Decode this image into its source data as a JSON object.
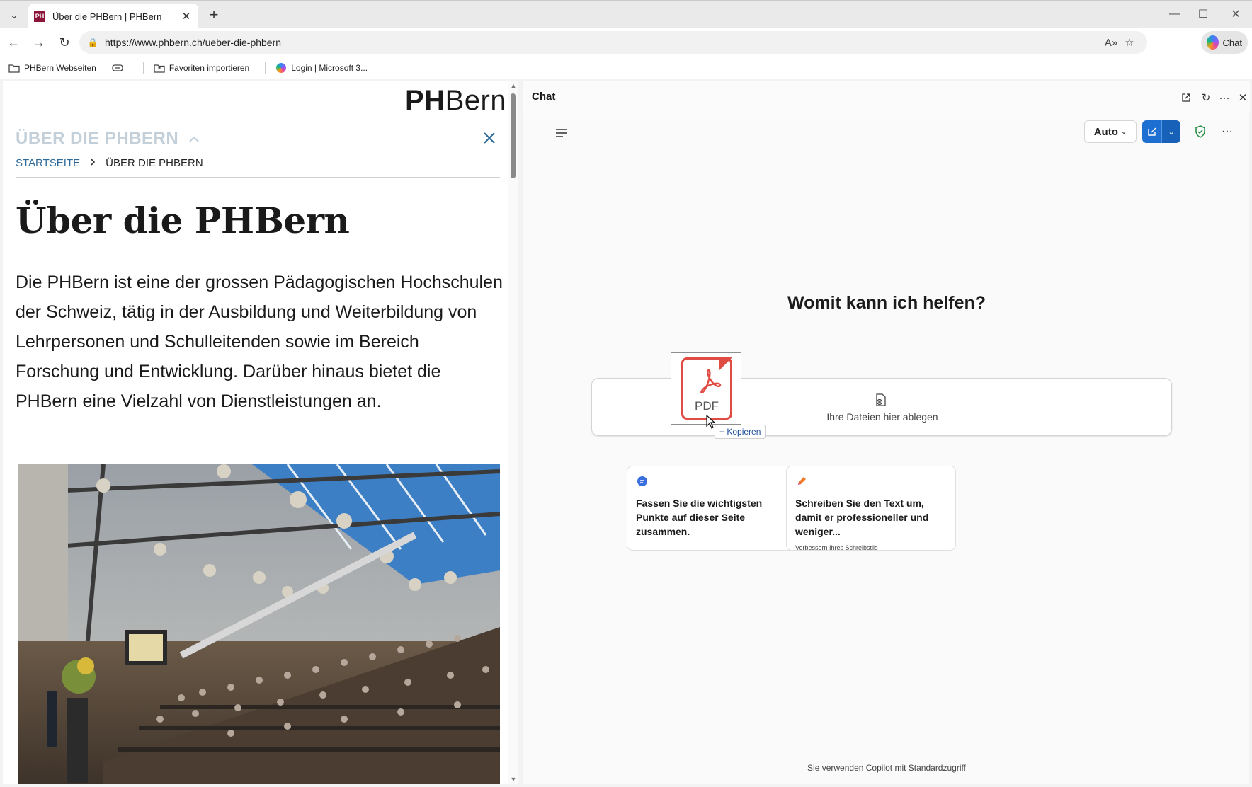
{
  "browser": {
    "tab": {
      "favicon_text": "PH",
      "title": "Über die PHBern | PHBern"
    },
    "url": "https://www.phbern.ch/ueber-die-phbern",
    "chat_button": "Chat",
    "favorites": [
      {
        "label": "PHBern Webseiten",
        "icon": "folder-icon"
      },
      {
        "label": "Favoriten importieren",
        "icon": "import-icon"
      },
      {
        "label": "Login | Microsoft 3...",
        "icon": "microsoft-icon"
      }
    ]
  },
  "page": {
    "logo_bold": "PH",
    "logo_rest": "Bern",
    "section_title": "ÜBER DIE PHBERN",
    "breadcrumb": {
      "home": "STARTSEITE",
      "current": "ÜBER DIE PHBERN"
    },
    "heading": "Über die PHBern",
    "lead": "Die PHBern ist eine der grossen Pädagogischen Hochschulen der Schweiz, tätig in der Ausbildung und Weiterbildung von Lehrpersonen und Schulleitenden sowie im Bereich Forschung und Entwicklung. Darüber hinaus bietet die PHBern eine Vielzahl von Dienstleistungen an."
  },
  "copilot": {
    "title": "Chat",
    "mode": "Auto",
    "greeting": "Womit kann ich helfen?",
    "dropzone_text": "Ihre Dateien hier ablegen",
    "drag_file_label": "PDF",
    "copy_tooltip": "+ Kopieren",
    "cards": [
      {
        "text": "Fassen Sie die wichtigsten Punkte auf dieser Seite zusammen.",
        "sub": ""
      },
      {
        "text": "Schreiben Sie den Text um, damit er professioneller und weniger...",
        "sub": "Verbessern Ihres Schreibstils"
      }
    ],
    "footer": "Sie verwenden Copilot mit Standardzugriff"
  },
  "colors": {
    "brand_red": "#8a1538",
    "link_blue": "#2d6a9a",
    "copilot_blue": "#1d6fd1",
    "pdf_red": "#e04b44"
  }
}
